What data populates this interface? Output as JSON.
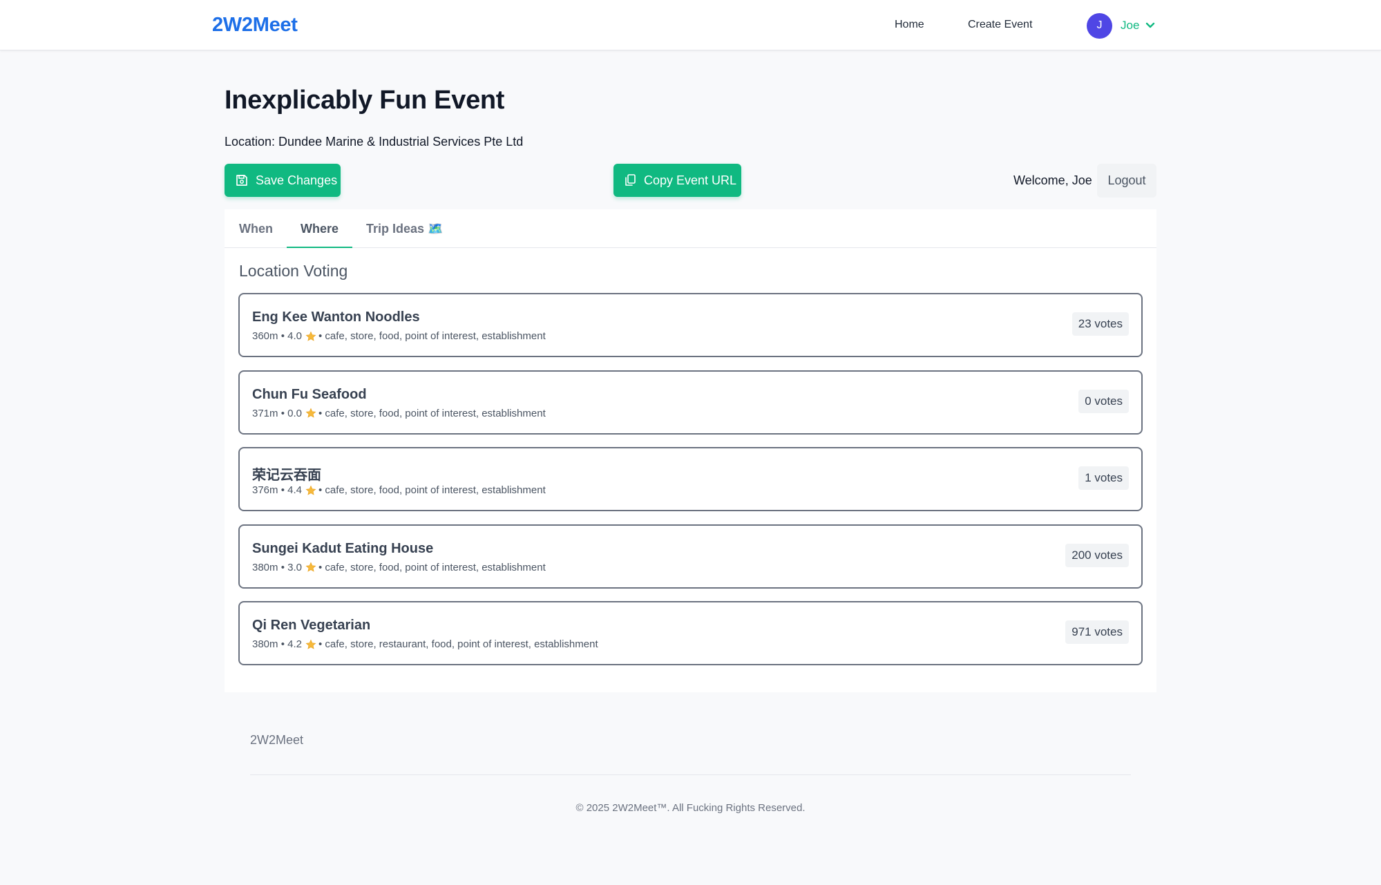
{
  "nav": {
    "brand": "2W2Meet",
    "links": [
      "Home",
      "Create Event"
    ],
    "user": {
      "initial": "J",
      "name": "Joe"
    }
  },
  "event": {
    "title": "Inexplicably Fun Event",
    "location": "Location: Dundee Marine & Industrial Services Pte Ltd"
  },
  "actions": {
    "save_label": "Save Changes",
    "copy_label": "Copy Event URL",
    "welcome": "Welcome, Joe",
    "logout_label": "Logout"
  },
  "tabs": [
    {
      "label": "When"
    },
    {
      "label": "Where",
      "active": true
    },
    {
      "label": "Trip Ideas 🗺️"
    }
  ],
  "section_title": "Location Voting",
  "locations": [
    {
      "name": "Eng Kee Wanton Noodles",
      "distance": "360m",
      "rating": "4.0",
      "types": "cafe, store, food, point of interest, establishment",
      "votes": "23 votes"
    },
    {
      "name": "Chun Fu Seafood",
      "distance": "371m",
      "rating": "0.0",
      "types": "cafe, store, food, point of interest, establishment",
      "votes": "0 votes"
    },
    {
      "name": "荣记云吞面",
      "distance": "376m",
      "rating": "4.4",
      "types": "cafe, store, food, point of interest, establishment",
      "votes": "1 votes"
    },
    {
      "name": "Sungei Kadut Eating House",
      "distance": "380m",
      "rating": "3.0",
      "types": "cafe, store, food, point of interest, establishment",
      "votes": "200 votes"
    },
    {
      "name": "Qi Ren Vegetarian",
      "distance": "380m",
      "rating": "4.2",
      "types": "cafe, store, restaurant, food, point of interest, establishment",
      "votes": "971 votes"
    }
  ],
  "footer": {
    "brand": "2W2Meet",
    "copyright": "© 2025 2W2Meet™. All Fucking Rights Reserved."
  },
  "colors": {
    "brand": "#1d6fe8",
    "accent": "#10b981",
    "avatar": "#4f46e5"
  }
}
